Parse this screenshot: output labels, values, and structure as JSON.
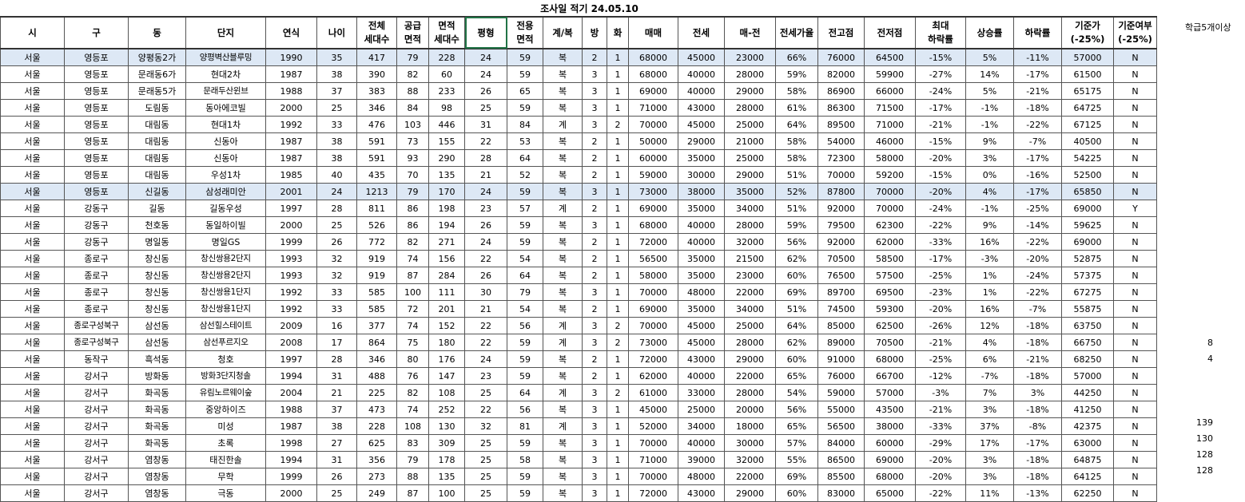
{
  "title": "조사일 적기 24.05.10",
  "side_header": "학급5개이상",
  "headers": [
    "시",
    "구",
    "동",
    "단지",
    "연식",
    "나이",
    "전체\n세대수",
    "공급\n면적",
    "면적\n세대수",
    "평형",
    "전용\n면적",
    "계/복",
    "방",
    "화",
    "매매",
    "전세",
    "매-전",
    "전세가율",
    "전고점",
    "전저점",
    "최대\n하락률",
    "상승률",
    "하락률",
    "기준가\n(-25%)",
    "기준여부\n(-25%)"
  ],
  "rows": [
    [
      "서울",
      "영등포",
      "양평동2가",
      "양평벽산블루밍",
      "1990",
      "35",
      "417",
      "79",
      "228",
      "24",
      "59",
      "복",
      "2",
      "1",
      "68000",
      "45000",
      "23000",
      "66%",
      "76000",
      "64500",
      "-15%",
      "5%",
      "-11%",
      "57000",
      "N"
    ],
    [
      "서울",
      "영등포",
      "문래동6가",
      "현대2차",
      "1987",
      "38",
      "390",
      "82",
      "60",
      "24",
      "59",
      "복",
      "3",
      "1",
      "68000",
      "40000",
      "28000",
      "59%",
      "82000",
      "59900",
      "-27%",
      "14%",
      "-17%",
      "61500",
      "N"
    ],
    [
      "서울",
      "영등포",
      "문래동5가",
      "문래두산윈브",
      "1988",
      "37",
      "383",
      "88",
      "233",
      "26",
      "65",
      "복",
      "3",
      "1",
      "69000",
      "40000",
      "29000",
      "58%",
      "86900",
      "66000",
      "-24%",
      "5%",
      "-21%",
      "65175",
      "N"
    ],
    [
      "서울",
      "영등포",
      "도림동",
      "동아에코빌",
      "2000",
      "25",
      "346",
      "84",
      "98",
      "25",
      "59",
      "복",
      "3",
      "1",
      "71000",
      "43000",
      "28000",
      "61%",
      "86300",
      "71500",
      "-17%",
      "-1%",
      "-18%",
      "64725",
      "N"
    ],
    [
      "서울",
      "영등포",
      "대림동",
      "현대1차",
      "1992",
      "33",
      "476",
      "103",
      "446",
      "31",
      "84",
      "계",
      "3",
      "2",
      "70000",
      "45000",
      "25000",
      "64%",
      "89500",
      "71000",
      "-21%",
      "-1%",
      "-22%",
      "67125",
      "N"
    ],
    [
      "서울",
      "영등포",
      "대림동",
      "신동아",
      "1987",
      "38",
      "591",
      "73",
      "155",
      "22",
      "53",
      "복",
      "2",
      "1",
      "50000",
      "29000",
      "21000",
      "58%",
      "54000",
      "46000",
      "-15%",
      "9%",
      "-7%",
      "40500",
      "N"
    ],
    [
      "서울",
      "영등포",
      "대림동",
      "신동아",
      "1987",
      "38",
      "591",
      "93",
      "290",
      "28",
      "64",
      "복",
      "2",
      "1",
      "60000",
      "35000",
      "25000",
      "58%",
      "72300",
      "58000",
      "-20%",
      "3%",
      "-17%",
      "54225",
      "N"
    ],
    [
      "서울",
      "영등포",
      "대림동",
      "우성1차",
      "1985",
      "40",
      "435",
      "70",
      "135",
      "21",
      "52",
      "복",
      "2",
      "1",
      "59000",
      "30000",
      "29000",
      "51%",
      "70000",
      "59200",
      "-15%",
      "0%",
      "-16%",
      "52500",
      "N"
    ],
    [
      "서울",
      "영등포",
      "신길동",
      "삼성래미안",
      "2001",
      "24",
      "1213",
      "79",
      "170",
      "24",
      "59",
      "복",
      "3",
      "1",
      "73000",
      "38000",
      "35000",
      "52%",
      "87800",
      "70000",
      "-20%",
      "4%",
      "-17%",
      "65850",
      "N"
    ],
    [
      "서울",
      "강동구",
      "길동",
      "길동우성",
      "1997",
      "28",
      "811",
      "86",
      "198",
      "23",
      "57",
      "계",
      "2",
      "1",
      "69000",
      "35000",
      "34000",
      "51%",
      "92000",
      "70000",
      "-24%",
      "-1%",
      "-25%",
      "69000",
      "Y"
    ],
    [
      "서울",
      "강동구",
      "천호동",
      "동일하이빌",
      "2000",
      "25",
      "526",
      "86",
      "194",
      "26",
      "59",
      "복",
      "3",
      "1",
      "68000",
      "40000",
      "28000",
      "59%",
      "79500",
      "62300",
      "-22%",
      "9%",
      "-14%",
      "59625",
      "N"
    ],
    [
      "서울",
      "강동구",
      "명일동",
      "명일GS",
      "1999",
      "26",
      "772",
      "82",
      "271",
      "24",
      "59",
      "복",
      "2",
      "1",
      "72000",
      "40000",
      "32000",
      "56%",
      "92000",
      "62000",
      "-33%",
      "16%",
      "-22%",
      "69000",
      "N"
    ],
    [
      "서울",
      "종로구",
      "창신동",
      "창신쌍용2단지",
      "1993",
      "32",
      "919",
      "74",
      "156",
      "22",
      "54",
      "복",
      "2",
      "1",
      "56500",
      "35000",
      "21500",
      "62%",
      "70500",
      "58500",
      "-17%",
      "-3%",
      "-20%",
      "52875",
      "N"
    ],
    [
      "서울",
      "종로구",
      "창신동",
      "창신쌍용2단지",
      "1993",
      "32",
      "919",
      "87",
      "284",
      "26",
      "64",
      "복",
      "2",
      "1",
      "58000",
      "35000",
      "23000",
      "60%",
      "76500",
      "57500",
      "-25%",
      "1%",
      "-24%",
      "57375",
      "N"
    ],
    [
      "서울",
      "종로구",
      "창신동",
      "창신쌍용1단지",
      "1992",
      "33",
      "585",
      "100",
      "111",
      "30",
      "79",
      "복",
      "3",
      "1",
      "70000",
      "48000",
      "22000",
      "69%",
      "89700",
      "69500",
      "-23%",
      "1%",
      "-22%",
      "67275",
      "N"
    ],
    [
      "서울",
      "종로구",
      "창신동",
      "창신쌍용1단지",
      "1992",
      "33",
      "585",
      "72",
      "201",
      "21",
      "54",
      "복",
      "2",
      "1",
      "69000",
      "35000",
      "34000",
      "51%",
      "74500",
      "59300",
      "-20%",
      "16%",
      "-7%",
      "55875",
      "N"
    ],
    [
      "서울",
      "종로구성북구",
      "삼선동",
      "삼선힐스테이트",
      "2009",
      "16",
      "377",
      "74",
      "152",
      "22",
      "56",
      "계",
      "3",
      "2",
      "70000",
      "45000",
      "25000",
      "64%",
      "85000",
      "62500",
      "-26%",
      "12%",
      "-18%",
      "63750",
      "N"
    ],
    [
      "서울",
      "종로구성북구",
      "삼선동",
      "삼선푸르지오",
      "2008",
      "17",
      "864",
      "75",
      "180",
      "22",
      "59",
      "계",
      "3",
      "2",
      "73000",
      "45000",
      "28000",
      "62%",
      "89000",
      "70500",
      "-21%",
      "4%",
      "-18%",
      "66750",
      "N"
    ],
    [
      "서울",
      "동작구",
      "흑석동",
      "청호",
      "1997",
      "28",
      "346",
      "80",
      "176",
      "24",
      "59",
      "복",
      "2",
      "1",
      "72000",
      "43000",
      "29000",
      "60%",
      "91000",
      "68000",
      "-25%",
      "6%",
      "-21%",
      "68250",
      "N"
    ],
    [
      "서울",
      "강서구",
      "방화동",
      "방화3단지청솔",
      "1994",
      "31",
      "488",
      "76",
      "147",
      "23",
      "59",
      "복",
      "2",
      "1",
      "62000",
      "40000",
      "22000",
      "65%",
      "76000",
      "66700",
      "-12%",
      "-7%",
      "-18%",
      "57000",
      "N"
    ],
    [
      "서울",
      "강서구",
      "화곡동",
      "유림노르웨이숲",
      "2004",
      "21",
      "225",
      "82",
      "108",
      "25",
      "64",
      "계",
      "3",
      "2",
      "61000",
      "33000",
      "28000",
      "54%",
      "59000",
      "57000",
      "-3%",
      "7%",
      "3%",
      "44250",
      "N"
    ],
    [
      "서울",
      "강서구",
      "화곡동",
      "중앙하이즈",
      "1988",
      "37",
      "473",
      "74",
      "252",
      "22",
      "56",
      "복",
      "3",
      "1",
      "45000",
      "25000",
      "20000",
      "56%",
      "55000",
      "43500",
      "-21%",
      "3%",
      "-18%",
      "41250",
      "N"
    ],
    [
      "서울",
      "강서구",
      "화곡동",
      "미성",
      "1987",
      "38",
      "228",
      "108",
      "130",
      "32",
      "81",
      "계",
      "3",
      "1",
      "52000",
      "34000",
      "18000",
      "65%",
      "56500",
      "38000",
      "-33%",
      "37%",
      "-8%",
      "42375",
      "N"
    ],
    [
      "서울",
      "강서구",
      "화곡동",
      "초록",
      "1998",
      "27",
      "625",
      "83",
      "309",
      "25",
      "59",
      "복",
      "3",
      "1",
      "70000",
      "40000",
      "30000",
      "57%",
      "84000",
      "60000",
      "-29%",
      "17%",
      "-17%",
      "63000",
      "N"
    ],
    [
      "서울",
      "강서구",
      "염창동",
      "태진한솔",
      "1994",
      "31",
      "356",
      "79",
      "178",
      "25",
      "58",
      "복",
      "3",
      "1",
      "71000",
      "39000",
      "32000",
      "55%",
      "86500",
      "69000",
      "-20%",
      "3%",
      "-18%",
      "64875",
      "N"
    ],
    [
      "서울",
      "강서구",
      "염창동",
      "무학",
      "1999",
      "26",
      "273",
      "88",
      "135",
      "25",
      "59",
      "복",
      "3",
      "1",
      "70000",
      "48000",
      "22000",
      "69%",
      "85500",
      "68000",
      "-20%",
      "3%",
      "-18%",
      "64125",
      "N"
    ],
    [
      "서울",
      "강서구",
      "염창동",
      "극동",
      "2000",
      "25",
      "249",
      "87",
      "100",
      "25",
      "59",
      "복",
      "3",
      "1",
      "72000",
      "43000",
      "29000",
      "60%",
      "83000",
      "65000",
      "-22%",
      "11%",
      "-13%",
      "62250",
      "N"
    ]
  ],
  "side_values": [
    {
      "row": 18,
      "value": "8"
    },
    {
      "row": 19,
      "value": "4"
    },
    {
      "row": 23,
      "value": "139"
    },
    {
      "row": 24,
      "value": "130"
    },
    {
      "row": 25,
      "value": "128"
    },
    {
      "row": 26,
      "value": "128"
    }
  ],
  "highlighted_rows": [
    0,
    8
  ],
  "selected_column": 9
}
